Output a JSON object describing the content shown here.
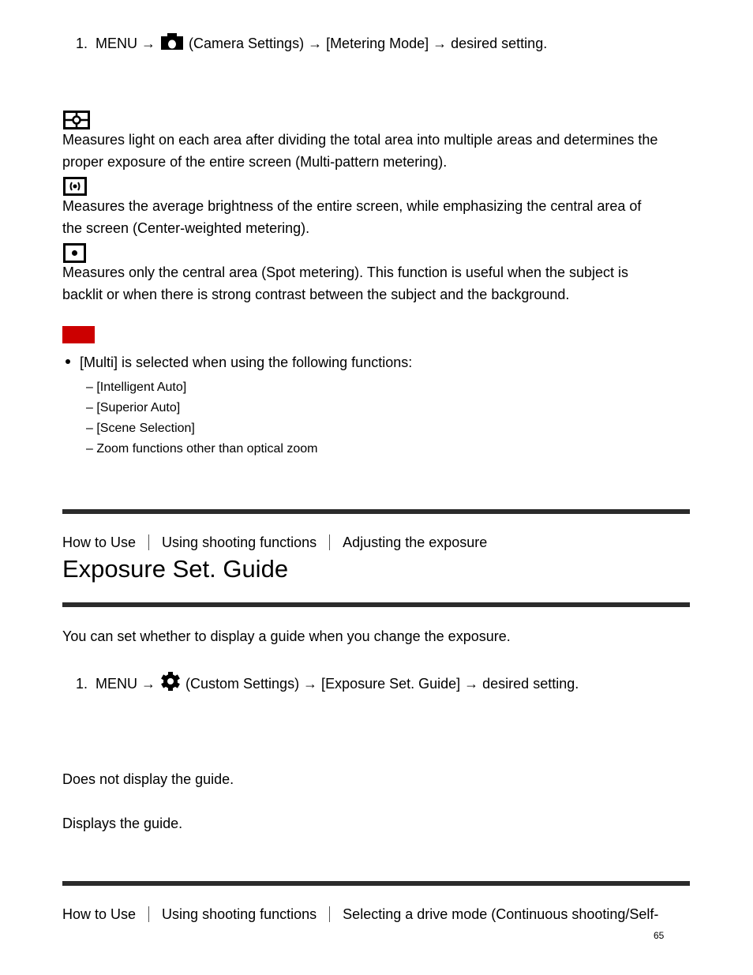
{
  "section1": {
    "step": {
      "number": "1.",
      "prefix": "MENU →",
      "icon": "camera-icon",
      "suffix": "(Camera Settings) → [Metering Mode] → desired setting."
    },
    "options": [
      {
        "icon": "multi-metering-icon",
        "line1": "Measures light on each area after dividing the total area into multiple areas and determines the",
        "line2": "proper exposure of the entire screen (Multi-pattern metering)."
      },
      {
        "icon": "center-metering-icon",
        "line1": "Measures the average brightness of the entire screen, while emphasizing the central area of",
        "line2": "the screen (Center-weighted metering)."
      },
      {
        "icon": "spot-metering-icon",
        "line1": "Measures only the central area (Spot metering). This function is useful when the subject is",
        "line2": "backlit or when there is strong contrast between the subject and the background."
      }
    ],
    "note_label_color": "#cc0000",
    "note": {
      "bullet": "[Multi] is selected when using the following functions:",
      "sub_items": [
        "– [Intelligent Auto]",
        "– [Superior Auto]",
        "– [Scene Selection]",
        "– Zoom functions other than optical zoom"
      ]
    }
  },
  "section2": {
    "breadcrumb": [
      "How to Use",
      "Using shooting functions",
      "Adjusting the exposure"
    ],
    "title": "Exposure Set. Guide",
    "intro": "You can set whether to display a guide when you change the exposure.",
    "step": {
      "number": "1.",
      "prefix": "MENU →",
      "icon": "gear-icon",
      "suffix": "(Custom Settings) → [Exposure Set. Guide] → desired setting."
    },
    "options": [
      "Does not display the guide.",
      "Displays the guide."
    ]
  },
  "section3": {
    "breadcrumb": [
      "How to Use",
      "Using shooting functions",
      "Selecting a drive mode (Continuous shooting/Self-"
    ]
  },
  "page_number": "65"
}
